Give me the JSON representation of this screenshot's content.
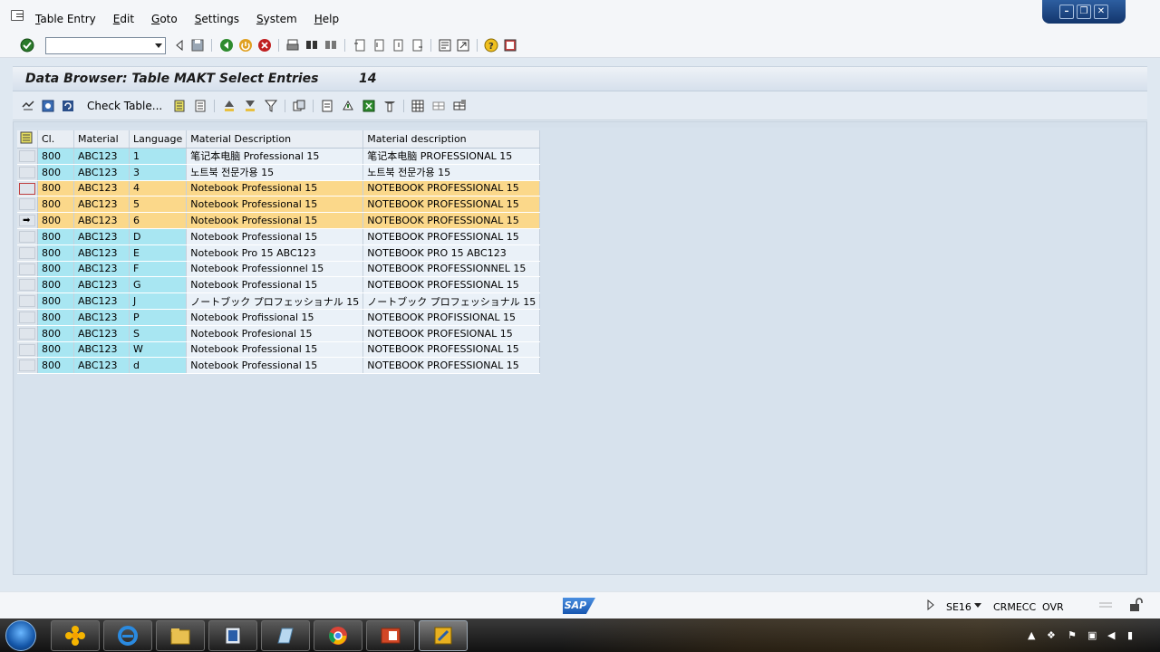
{
  "menu": {
    "items": [
      {
        "label": "Table Entry",
        "ul": "T",
        "rest": "able Entry"
      },
      {
        "label": "Edit",
        "ul": "E",
        "rest": "dit"
      },
      {
        "label": "Goto",
        "ul": "G",
        "rest": "oto"
      },
      {
        "label": "Settings",
        "ul": "S",
        "rest": "ettings"
      },
      {
        "label": "System",
        "ul": "S",
        "rest": "ystem"
      },
      {
        "label": "Help",
        "ul": "H",
        "rest": "elp"
      }
    ]
  },
  "command_field": {
    "value": ""
  },
  "title": {
    "text": "Data Browser: Table MAKT Select Entries",
    "count": "14"
  },
  "app_toolbar": {
    "check_table_label": "Check Table..."
  },
  "grid": {
    "headers": [
      "Cl.",
      "Material",
      "Language",
      "Material Description",
      "Material description"
    ],
    "rows": [
      {
        "cl": "800",
        "material": "ABC123",
        "language": "1",
        "desc": "笔记本电脑 Professional 15",
        "desc_upper": "笔记本电脑 PROFESSIONAL 15",
        "highlight": false
      },
      {
        "cl": "800",
        "material": "ABC123",
        "language": "3",
        "desc": "노트북 전문가용 15",
        "desc_upper": "노트북 전문가용 15",
        "highlight": false
      },
      {
        "cl": "800",
        "material": "ABC123",
        "language": "4",
        "desc": "Notebook Professional 15",
        "desc_upper": "NOTEBOOK PROFESSIONAL 15",
        "highlight": true
      },
      {
        "cl": "800",
        "material": "ABC123",
        "language": "5",
        "desc": "Notebook Professional 15",
        "desc_upper": "NOTEBOOK PROFESSIONAL 15",
        "highlight": true
      },
      {
        "cl": "800",
        "material": "ABC123",
        "language": "6",
        "desc": "Notebook Professional 15",
        "desc_upper": "NOTEBOOK PROFESSIONAL 15",
        "highlight": true
      },
      {
        "cl": "800",
        "material": "ABC123",
        "language": "D",
        "desc": "Notebook Professional 15",
        "desc_upper": "NOTEBOOK PROFESSIONAL 15",
        "highlight": false
      },
      {
        "cl": "800",
        "material": "ABC123",
        "language": "E",
        "desc": "Notebook Pro 15 ABC123",
        "desc_upper": "NOTEBOOK PRO 15 ABC123",
        "highlight": false
      },
      {
        "cl": "800",
        "material": "ABC123",
        "language": "F",
        "desc": "Notebook Professionnel 15",
        "desc_upper": "NOTEBOOK PROFESSIONNEL 15",
        "highlight": false
      },
      {
        "cl": "800",
        "material": "ABC123",
        "language": "G",
        "desc": "Notebook Professional 15",
        "desc_upper": "NOTEBOOK PROFESSIONAL 15",
        "highlight": false
      },
      {
        "cl": "800",
        "material": "ABC123",
        "language": "J",
        "desc": "ノートブック プロフェッショナル 15",
        "desc_upper": "ノートブック プロフェッショナル 15",
        "highlight": false
      },
      {
        "cl": "800",
        "material": "ABC123",
        "language": "P",
        "desc": "Notebook Profissional 15",
        "desc_upper": "NOTEBOOK PROFISSIONAL 15",
        "highlight": false
      },
      {
        "cl": "800",
        "material": "ABC123",
        "language": "S",
        "desc": "Notebook Profesional 15",
        "desc_upper": "NOTEBOOK PROFESIONAL 15",
        "highlight": false
      },
      {
        "cl": "800",
        "material": "ABC123",
        "language": "W",
        "desc": "Notebook Professional 15",
        "desc_upper": "NOTEBOOK PROFESSIONAL 15",
        "highlight": false
      },
      {
        "cl": "800",
        "material": "ABC123",
        "language": "d",
        "desc": "Notebook Professional 15",
        "desc_upper": "NOTEBOOK PROFESSIONAL 15",
        "highlight": false
      }
    ],
    "current_row_index": 2,
    "pointer_row_index": 4
  },
  "status": {
    "logo": "SAP",
    "transaction": "SE16",
    "system": "CRMECC",
    "mode": "OVR"
  },
  "colors": {
    "key_cell": "#a8e6f2",
    "highlight_row": "#fbd88a",
    "content_bg": "#d7e2ed"
  }
}
